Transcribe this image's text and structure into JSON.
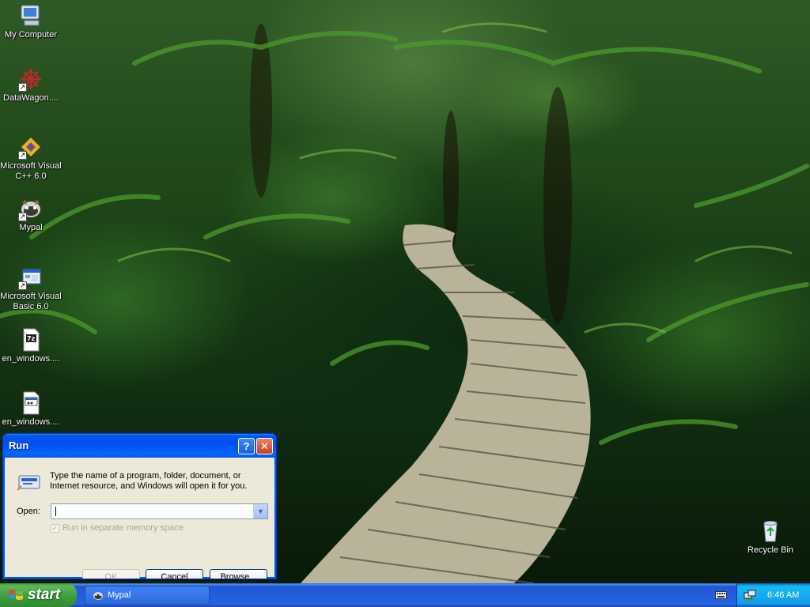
{
  "desktop": {
    "icons": [
      {
        "label": "My Computer",
        "icon": "my-computer-icon"
      },
      {
        "label": "DataWagon....",
        "icon": "datawagon-icon"
      },
      {
        "label": "Microsoft Visual C++ 6.0",
        "icon": "visual-cpp-icon"
      },
      {
        "label": "Mypal",
        "icon": "mypal-icon"
      },
      {
        "label": "Microsoft Visual Basic 6.0",
        "icon": "visual-basic-icon"
      },
      {
        "label": "en_windows....",
        "icon": "7z-archive-icon"
      },
      {
        "label": "en_windows....",
        "icon": "disk-image-icon"
      },
      {
        "label": "Recycle Bin",
        "icon": "recycle-bin-icon"
      }
    ]
  },
  "run_dialog": {
    "title": "Run",
    "description": "Type the name of a program, folder, document, or Internet resource, and Windows will open it for you.",
    "open_label": "Open:",
    "open_value": "",
    "separate_memory_label": "Run in separate memory space",
    "separate_memory_checked": true,
    "separate_memory_enabled": false,
    "ok_label": "OK",
    "ok_enabled": false,
    "cancel_label": "Cancel",
    "browse_label": "Browse..."
  },
  "taskbar": {
    "start_label": "start",
    "tasks": [
      {
        "label": "Mypal",
        "icon": "mypal-icon"
      }
    ],
    "clock": "6:46 AM",
    "colors": {
      "taskbar": "#2458d6",
      "start": "#3b9e3b",
      "tray": "#139ee9"
    }
  }
}
